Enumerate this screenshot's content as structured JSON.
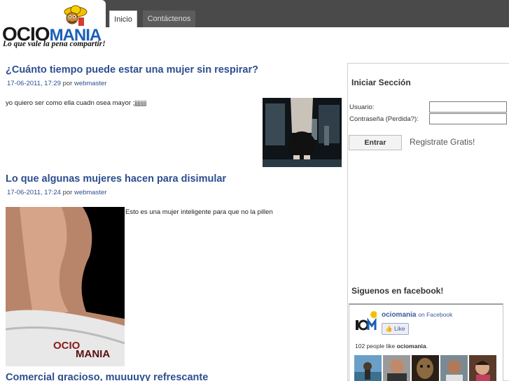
{
  "header": {
    "logo_ocio": "OCIO",
    "logo_mania": "MANIA",
    "tagline": "Lo que vale la pena compartir!",
    "tabs": [
      {
        "label": "Inicio",
        "active": true
      },
      {
        "label": "Contáctenos",
        "active": false
      }
    ]
  },
  "posts": [
    {
      "title": "¿Cuánto tiempo puede estar una mujer sin respirar?",
      "date": "17-06-2011, 17:29",
      "by": "por",
      "author": "webmaster",
      "body": "yo quiero ser como ella cuadn osea mayor ;jjjjjjjj"
    },
    {
      "title": "Lo que algunas mujeres hacen para disimular",
      "date": "17-06-2011, 17:24",
      "by": "por",
      "author": "webmaster",
      "body": "Esto es una mujer inteligente para que no la pillen",
      "watermark_ocio": "OCIO",
      "watermark_mania": "MANIA"
    },
    {
      "title": "Comercial gracioso, muuuuyy refrescante"
    }
  ],
  "sidebar": {
    "login_title": "Iniciar Sección",
    "user_label": "Usuario:",
    "pass_label": "Contraseña (Perdida?):",
    "user_value": "",
    "pass_value": "",
    "submit_label": "Entrar",
    "register_label": "Registrate Gratis!",
    "facebook_title": "Siguenos en facebook!",
    "fb": {
      "page_name": "ociomania",
      "on_facebook": "on Facebook",
      "like_label": "Like",
      "count_prefix": "102 people like",
      "count_page": "ociomania",
      "count_suffix": "."
    }
  },
  "colors": {
    "title_blue": "#2d4e8f",
    "topbar": "#4a4a4a",
    "facebook_blue": "#3b5998"
  }
}
